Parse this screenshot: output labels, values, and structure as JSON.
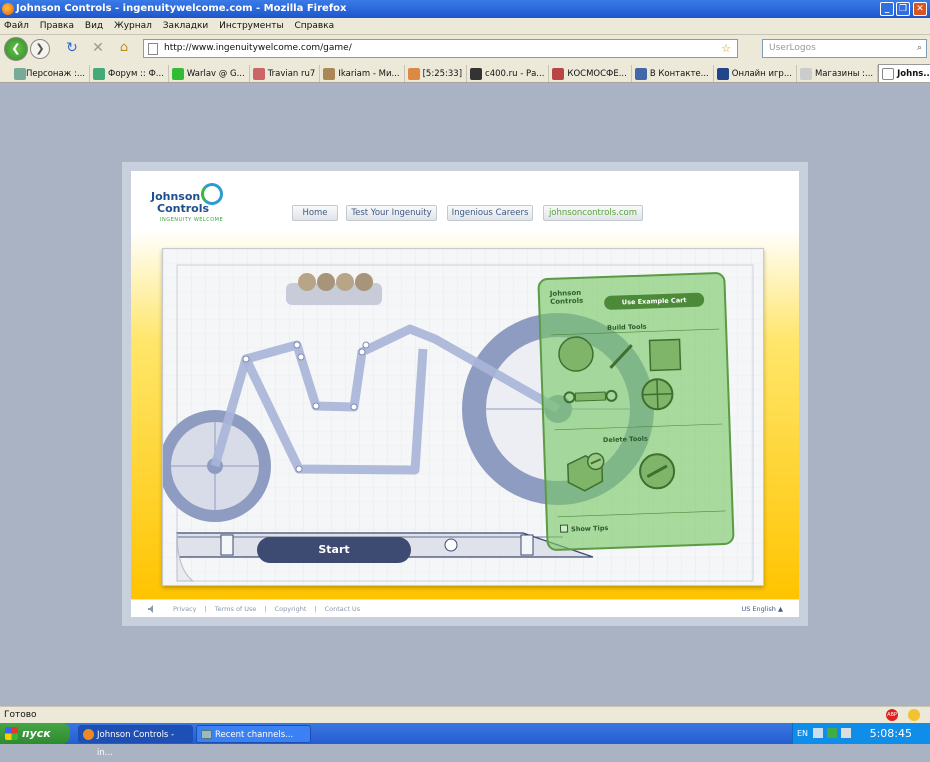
{
  "browser": {
    "title": "Johnson Controls - ingenuitywelcome.com - Mozilla Firefox",
    "menu": [
      "Файл",
      "Правка",
      "Вид",
      "Журнал",
      "Закладки",
      "Инструменты",
      "Справка"
    ],
    "url": "http://www.ingenuitywelcome.com/game/",
    "search_placeholder": "UserLogos",
    "bookmarks": [
      "Персонаж :...",
      "Форум :: Ф...",
      "Warlav @ G...",
      "Travian ru7",
      "Ikariam - Ми...",
      "[5:25:33]",
      "c400.ru - Ра...",
      "КОСМОСФЕ...",
      "В Контакте...",
      "Онлайн игр...",
      "Магазины :..."
    ],
    "active_tab": "Johns...",
    "status": "Готово"
  },
  "site": {
    "logo_line1": "Johnson",
    "logo_line2": "Controls",
    "logo_tagline": "INGENUITY WELCOME",
    "nav": [
      "Home",
      "Test Your Ingenuity",
      "Ingenious Careers",
      "johnsoncontrols.com"
    ],
    "game": {
      "start_label": "Start",
      "panel_logo_line1": "Johnson",
      "panel_logo_line2": "Controls",
      "example_label": "Use Example Cart",
      "build_tools_label": "Build Tools",
      "delete_tools_label": "Delete Tools",
      "show_tips_label": "Show Tips"
    },
    "footer": {
      "links": [
        "Privacy",
        "|",
        "Terms of Use",
        "|",
        "Copyright",
        "|",
        "Contact Us"
      ],
      "language": "US English ▲"
    }
  },
  "taskbar": {
    "start_label": "пуск",
    "tasks": [
      "Johnson Controls - in...",
      "Recent channels..."
    ],
    "lang": "EN",
    "clock": "5:08:45"
  }
}
